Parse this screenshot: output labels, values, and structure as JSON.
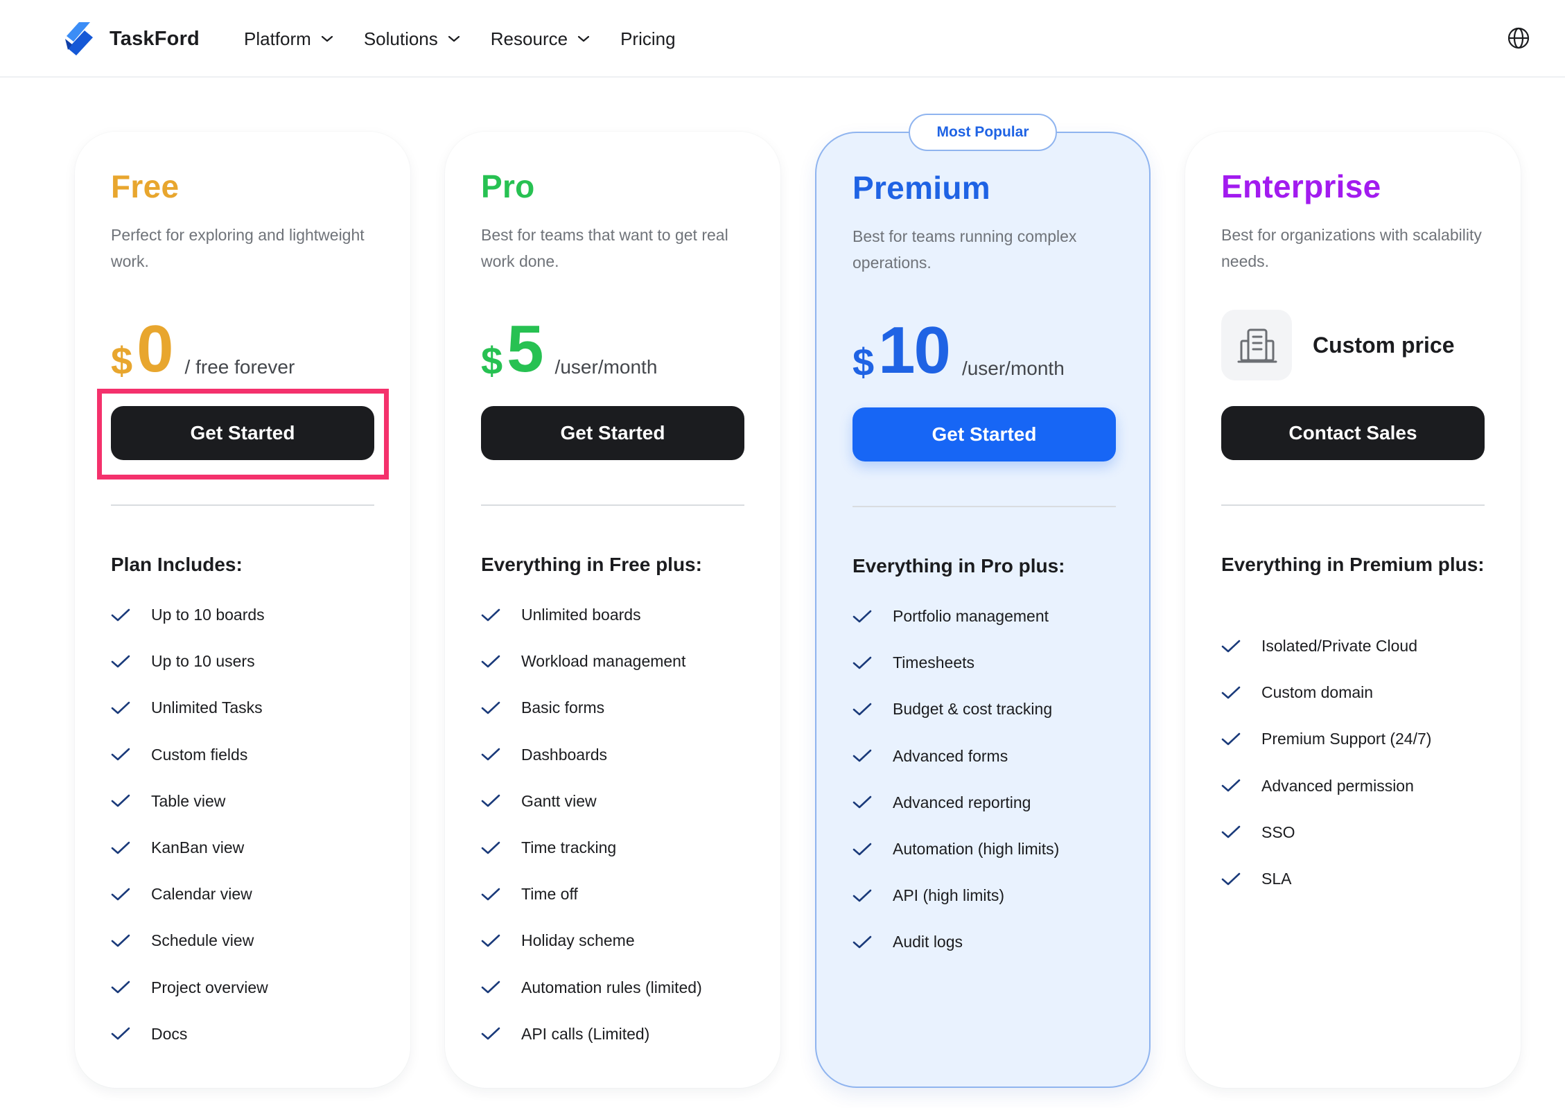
{
  "brand": {
    "name": "TaskFord"
  },
  "nav": {
    "items": [
      {
        "label": "Platform",
        "has_dropdown": true
      },
      {
        "label": "Solutions",
        "has_dropdown": true
      },
      {
        "label": "Resource",
        "has_dropdown": true
      },
      {
        "label": "Pricing",
        "has_dropdown": false
      }
    ],
    "right_icon": "globe-icon"
  },
  "colors": {
    "free": "#e8a62e",
    "pro": "#27c152",
    "premium": "#1f63e4",
    "enterprise": "#a21bef",
    "cta_dark": "#1b1c1f",
    "cta_blue": "#1766f5",
    "check": "#1a3a7a",
    "highlight": "#f4316c"
  },
  "plans": {
    "free": {
      "name": "Free",
      "description": "Perfect for exploring and lightweight work.",
      "currency": "$",
      "amount": "0",
      "period": "/ free forever",
      "cta": "Get Started",
      "features_heading": "Plan Includes:",
      "features": [
        "Up to 10 boards",
        "Up to 10 users",
        "Unlimited Tasks",
        "Custom fields",
        "Table view",
        "KanBan view",
        "Calendar view",
        "Schedule view",
        "Project overview",
        "Docs"
      ]
    },
    "pro": {
      "name": "Pro",
      "description": "Best for teams that want to get real work done.",
      "currency": "$",
      "amount": "5",
      "period": "/user/month",
      "cta": "Get Started",
      "features_heading": "Everything in Free plus:",
      "features": [
        "Unlimited boards",
        "Workload management",
        "Basic forms",
        "Dashboards",
        "Gantt view",
        "Time tracking",
        "Time off",
        "Holiday scheme",
        "Automation rules (limited)",
        "API calls (Limited)"
      ]
    },
    "premium": {
      "badge": "Most Popular",
      "name": "Premium",
      "description": "Best for teams running complex operations.",
      "currency": "$",
      "amount": "10",
      "period": "/user/month",
      "cta": "Get Started",
      "features_heading": "Everything in Pro plus:",
      "features": [
        "Portfolio management",
        "Timesheets",
        "Budget & cost tracking",
        "Advanced forms",
        "Advanced reporting",
        "Automation (high limits)",
        "API (high limits)",
        "Audit logs"
      ]
    },
    "enterprise": {
      "name": "Enterprise",
      "description": "Best for organizations with scalability needs.",
      "price_label": "Custom price",
      "price_icon": "building-icon",
      "cta": "Contact Sales",
      "features_heading": "Everything in Premium plus:",
      "features": [
        "Isolated/Private Cloud",
        "Custom domain",
        "Premium Support (24/7)",
        "Advanced permission",
        "SSO",
        "SLA"
      ]
    }
  }
}
